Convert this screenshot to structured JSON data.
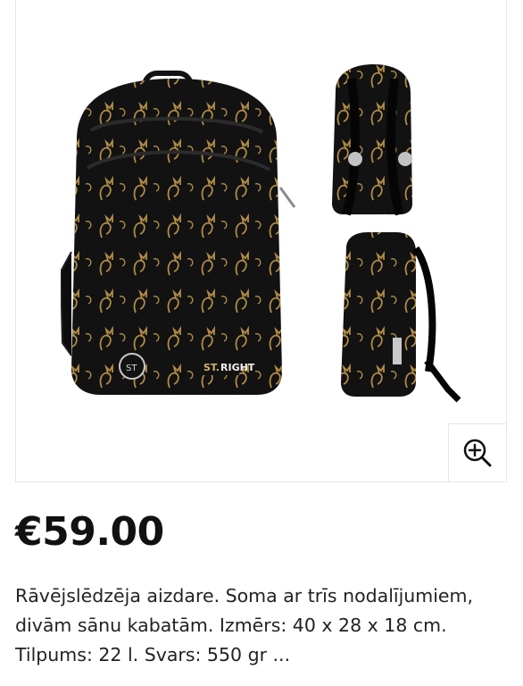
{
  "product": {
    "image_alt": "Backpack with gold cat pattern",
    "brand_badge_left": "ST",
    "brand_badge_right": "ST.RIGHT",
    "price": "€59.00",
    "description": "Rāvējslēdzēja aizdare. Soma ar trīs nodalījumiem, divām sānu kabatām. Izmērs: 40 x 28 x 18 cm. Tilpums: 22 l. Svars: 550 gr ..."
  },
  "zoom": {
    "icon": "zoom-in-icon"
  },
  "colors": {
    "bag_black": "#121212",
    "pattern_gold": "#b9924b",
    "border": "#e6e6e6"
  }
}
